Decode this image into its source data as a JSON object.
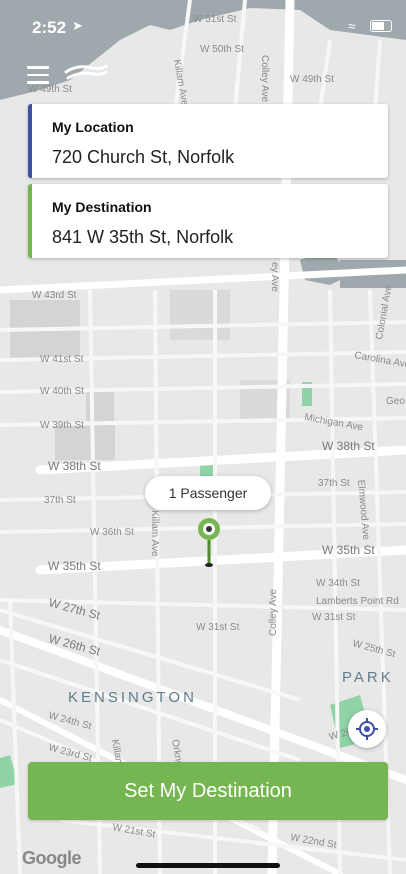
{
  "status_bar": {
    "time": "2:52"
  },
  "location_card": {
    "title": "My Location",
    "value": "720 Church St, Norfolk",
    "accent": "#3c4fa0"
  },
  "destination_card": {
    "title": "My Destination",
    "value": "841 W 35th St, Norfolk",
    "accent": "#76b652"
  },
  "passenger_bubble": {
    "label": "1 Passenger"
  },
  "set_destination_button": {
    "label": "Set My Destination",
    "color": "#76b652"
  },
  "map": {
    "streets": {
      "w51": "W 51st St",
      "w50": "W 50th St",
      "w49": "W 49th St",
      "w49b": "W 49th St",
      "w43": "W 43rd St",
      "w41": "W 41st St",
      "w40": "W 40th St",
      "w39": "W 39th St",
      "w38": "W 38th St",
      "w38b": "W 38th St",
      "w37": "37th St",
      "w37b": "37th St",
      "w36": "W 36th St",
      "w35": "W 35th St",
      "w35b": "W 35th St",
      "w34": "W 34th St",
      "w31": "W 31st St",
      "w31b": "W 31st St",
      "w27": "W 27th St",
      "w26": "W 26th St",
      "w26b": "W 26th St",
      "w25": "W 25th St",
      "w24": "W 24th St",
      "w23": "W 23rd St",
      "w21": "W 21st St",
      "w22": "W 22nd St",
      "colley1": "Colley Ave",
      "colley2": "ey Ave",
      "colley3": "Colley Ave",
      "colley4": "Colley Ave",
      "killam": "Killam Ave",
      "killam2": "Killam Ave",
      "lambert": "Lamberts Point Rd",
      "michigan": "Michigan Ave",
      "carolina": "Carolina Ave",
      "geo": "Geo",
      "colonial": "Colonial Ave",
      "orkney": "Orkney Ave",
      "elmwood": "Elmwood Ave",
      "killam3": "Killam Ave"
    },
    "areas": {
      "kensington": "KENSINGTON",
      "park": "PARK"
    },
    "attribution": "Google"
  },
  "icons": {
    "menu": "hamburger-icon",
    "logo": "app-logo-icon",
    "pin": "destination-pin-icon",
    "locate": "my-location-icon"
  }
}
